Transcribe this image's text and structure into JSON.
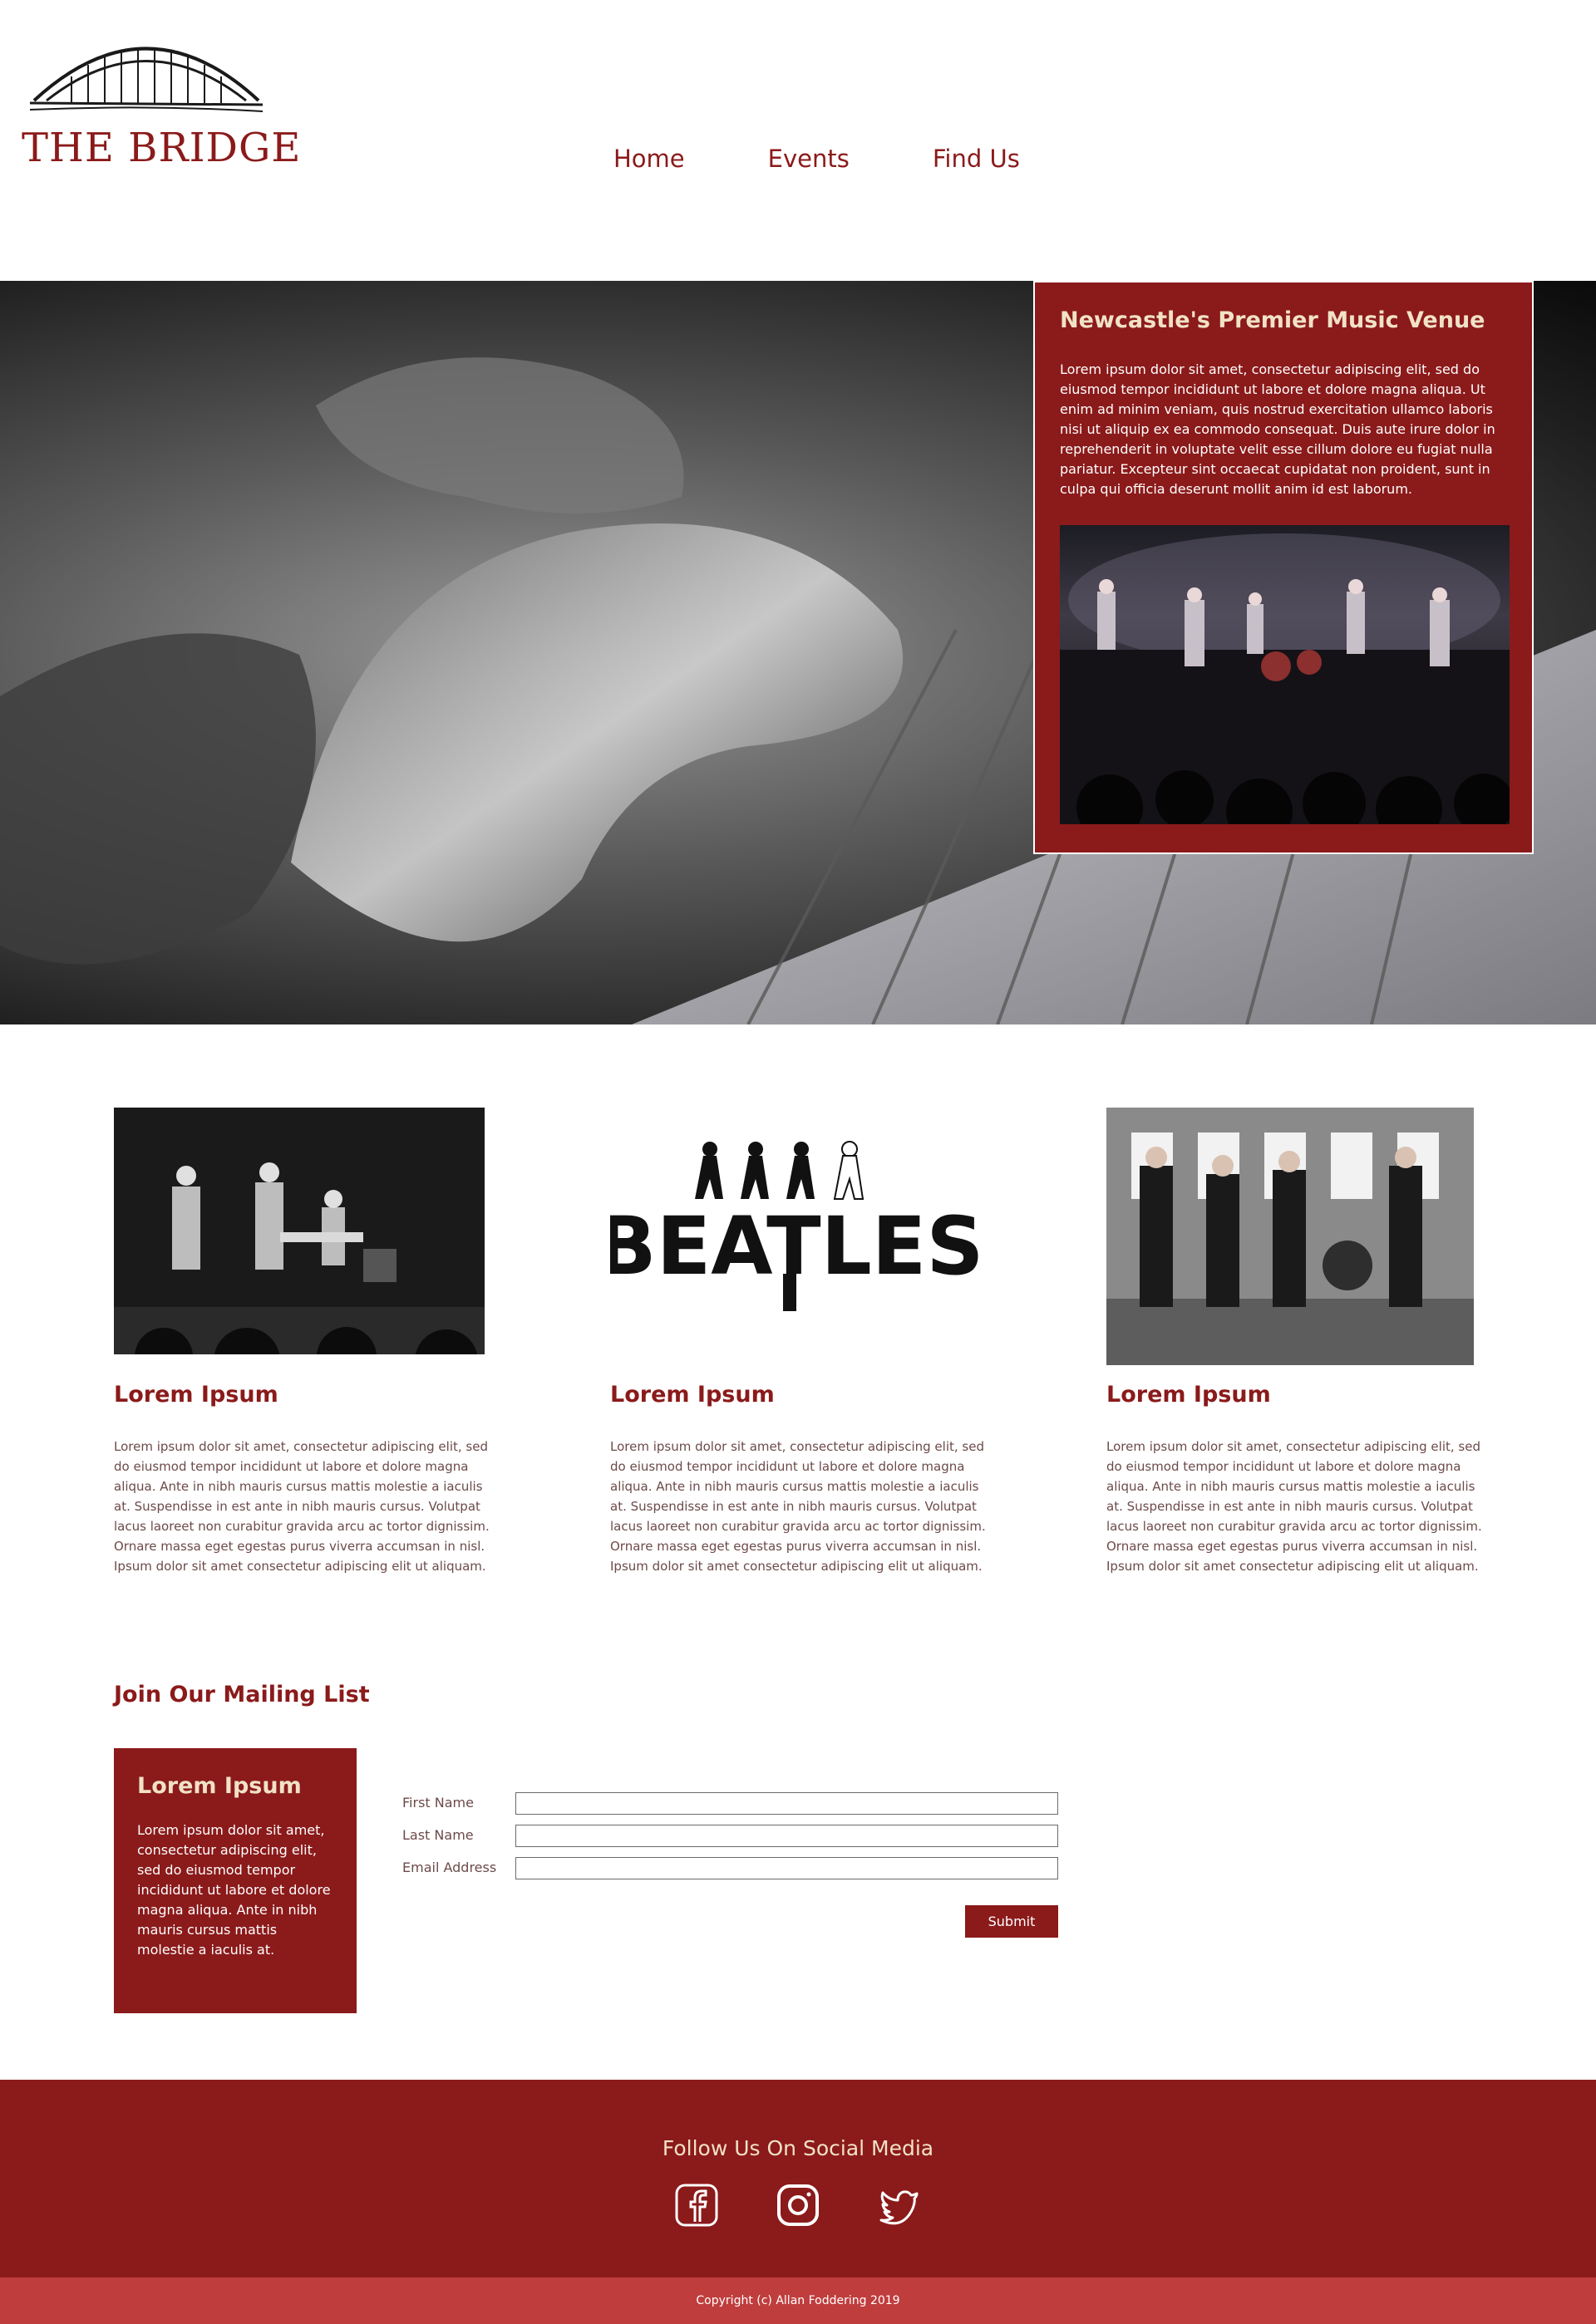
{
  "header": {
    "logo_text": "THE BRIDGE",
    "nav": [
      "Home",
      "Events",
      "Find Us"
    ]
  },
  "hero": {
    "card_title": "Newcastle's Premier Music Venue",
    "card_text": "Lorem ipsum dolor sit amet, consectetur adipiscing elit, sed do eiusmod tempor incididunt ut labore et dolore magna aliqua. Ut enim ad minim veniam, quis nostrud exercitation ullamco laboris nisi ut aliquip ex ea commodo consequat. Duis aute irure dolor in reprehenderit in voluptate velit esse cillum dolore eu fugiat nulla pariatur. Excepteur sint occaecat cupidatat non proident, sunt in culpa qui officia deserunt mollit anim id est laborum."
  },
  "features": [
    {
      "title": "Lorem Ipsum",
      "text": "Lorem ipsum dolor sit amet, consectetur adipiscing elit, sed do eiusmod tempor incididunt ut labore et dolore magna aliqua. Ante in nibh mauris cursus mattis molestie a iaculis at. Suspendisse in est ante in nibh mauris cursus. Volutpat lacus laoreet non curabitur gravida arcu ac tortor dignissim. Ornare massa eget egestas purus viverra accumsan in nisl. Ipsum dolor sit amet consectetur adipiscing elit ut aliquam."
    },
    {
      "title": "Lorem Ipsum",
      "logo_text": "BEATLES",
      "text": "Lorem ipsum dolor sit amet, consectetur adipiscing elit, sed do eiusmod tempor incididunt ut labore et dolore magna aliqua. Ante in nibh mauris cursus mattis molestie a iaculis at. Suspendisse in est ante in nibh mauris cursus. Volutpat lacus laoreet non curabitur gravida arcu ac tortor dignissim. Ornare massa eget egestas purus viverra accumsan in nisl. Ipsum dolor sit amet consectetur adipiscing elit ut aliquam."
    },
    {
      "title": "Lorem Ipsum",
      "text": "Lorem ipsum dolor sit amet, consectetur adipiscing elit, sed do eiusmod tempor incididunt ut labore et dolore magna aliqua. Ante in nibh mauris cursus mattis molestie a iaculis at. Suspendisse in est ante in nibh mauris cursus. Volutpat lacus laoreet non curabitur gravida arcu ac tortor dignissim. Ornare massa eget egestas purus viverra accumsan in nisl. Ipsum dolor sit amet consectetur adipiscing elit ut aliquam."
    }
  ],
  "mailing": {
    "title": "Join Our Mailing List",
    "card_title": "Lorem Ipsum",
    "card_text": "Lorem ipsum dolor sit amet, consectetur adipiscing elit, sed do eiusmod tempor incididunt ut labore et dolore magna aliqua. Ante in nibh mauris cursus mattis molestie a iaculis at.",
    "fields": [
      {
        "label": "First Name",
        "value": ""
      },
      {
        "label": "Last Name",
        "value": ""
      },
      {
        "label": "Email Address",
        "value": ""
      }
    ],
    "submit_label": "Submit"
  },
  "footer": {
    "title": "Follow Us On Social Media",
    "icons": [
      "facebook-icon",
      "instagram-icon",
      "twitter-icon"
    ],
    "copyright": "Copyright (c) Allan Foddering 2019"
  },
  "colors": {
    "brand": "#8b1a1a",
    "accent_text": "#f1e2c6",
    "copyright_bar": "#c03d3d"
  }
}
